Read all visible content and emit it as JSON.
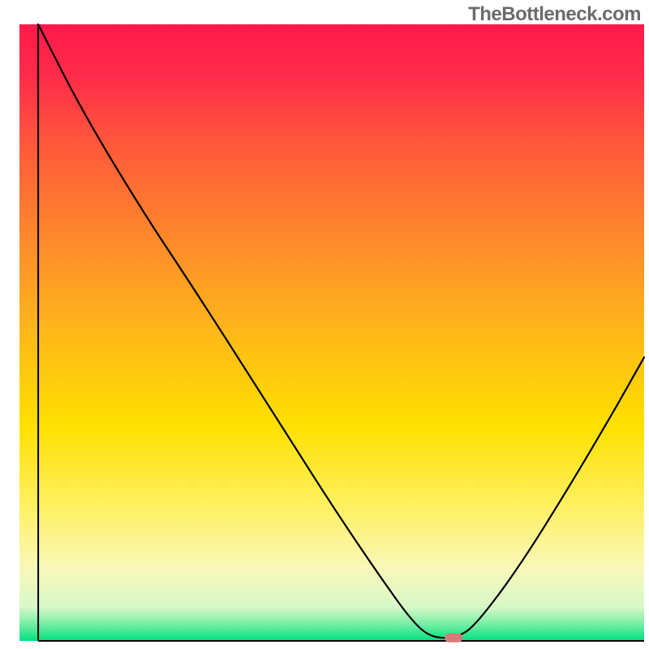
{
  "watermark": "TheBottleneck.com",
  "chart_data": {
    "type": "line",
    "title": "",
    "xlabel": "",
    "ylabel": "",
    "xlim": [
      0,
      100
    ],
    "ylim": [
      0,
      100
    ],
    "background_gradient": {
      "stops": [
        {
          "offset": 0.0,
          "color": "#ff1a4a"
        },
        {
          "offset": 0.08,
          "color": "#ff2a4a"
        },
        {
          "offset": 0.2,
          "color": "#ff5a3a"
        },
        {
          "offset": 0.35,
          "color": "#ff8a2a"
        },
        {
          "offset": 0.5,
          "color": "#ffb81a"
        },
        {
          "offset": 0.65,
          "color": "#ffe000"
        },
        {
          "offset": 0.78,
          "color": "#fff060"
        },
        {
          "offset": 0.88,
          "color": "#f8f8b8"
        },
        {
          "offset": 0.945,
          "color": "#d8f8c8"
        },
        {
          "offset": 0.97,
          "color": "#80f0a8"
        },
        {
          "offset": 1.0,
          "color": "#00e080"
        }
      ]
    },
    "series": [
      {
        "name": "bottleneck-curve",
        "color": "#000000",
        "width": 2.2,
        "points": [
          {
            "x": 3.0,
            "y": 100.0
          },
          {
            "x": 10.0,
            "y": 86.0
          },
          {
            "x": 19.5,
            "y": 70.0
          },
          {
            "x": 28.0,
            "y": 57.0
          },
          {
            "x": 40.0,
            "y": 38.0
          },
          {
            "x": 50.0,
            "y": 22.0
          },
          {
            "x": 58.0,
            "y": 10.0
          },
          {
            "x": 63.0,
            "y": 3.0
          },
          {
            "x": 66.0,
            "y": 0.5
          },
          {
            "x": 70.0,
            "y": 0.5
          },
          {
            "x": 73.0,
            "y": 2.5
          },
          {
            "x": 80.0,
            "y": 12.0
          },
          {
            "x": 88.0,
            "y": 25.0
          },
          {
            "x": 95.0,
            "y": 37.0
          },
          {
            "x": 100.0,
            "y": 46.0
          }
        ]
      }
    ],
    "marker": {
      "x": 69.5,
      "y": 0.5,
      "color": "#d97a7a",
      "rx": 10,
      "ry": 5
    },
    "axes": {
      "left": {
        "x1": 3,
        "y1": 0,
        "x2": 3,
        "y2": 100
      },
      "bottom": {
        "x1": 3,
        "y1": 0,
        "x2": 100,
        "y2": 0
      }
    }
  }
}
